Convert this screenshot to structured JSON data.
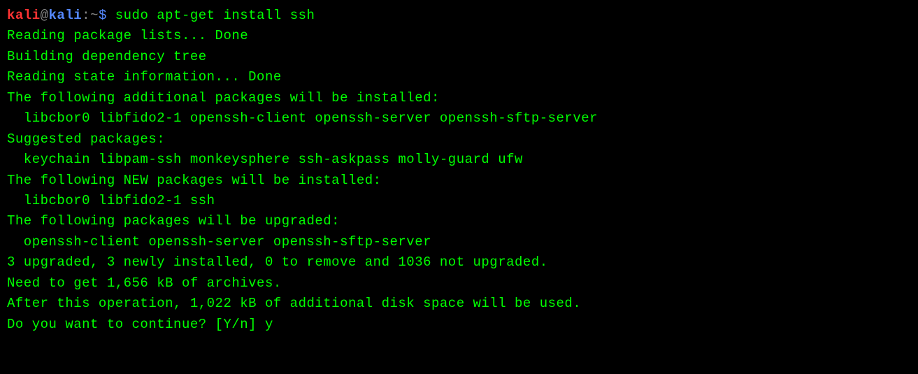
{
  "prompt": {
    "user": "kali",
    "at": "@",
    "host": "kali",
    "colon": ":",
    "path": "~",
    "symbol": "$ "
  },
  "command": "sudo apt-get install ssh",
  "lines": {
    "l1": "Reading package lists... Done",
    "l2": "Building dependency tree",
    "l3": "Reading state information... Done",
    "l4": "The following additional packages will be installed:",
    "l5": "  libcbor0 libfido2-1 openssh-client openssh-server openssh-sftp-server",
    "l6": "Suggested packages:",
    "l7": "  keychain libpam-ssh monkeysphere ssh-askpass molly-guard ufw",
    "l8": "The following NEW packages will be installed:",
    "l9": "  libcbor0 libfido2-1 ssh",
    "l10": "The following packages will be upgraded:",
    "l11": "  openssh-client openssh-server openssh-sftp-server",
    "l12": "3 upgraded, 3 newly installed, 0 to remove and 1036 not upgraded.",
    "l13": "Need to get 1,656 kB of archives.",
    "l14": "After this operation, 1,022 kB of additional disk space will be used.",
    "l15": "Do you want to continue? [Y/n] y"
  }
}
